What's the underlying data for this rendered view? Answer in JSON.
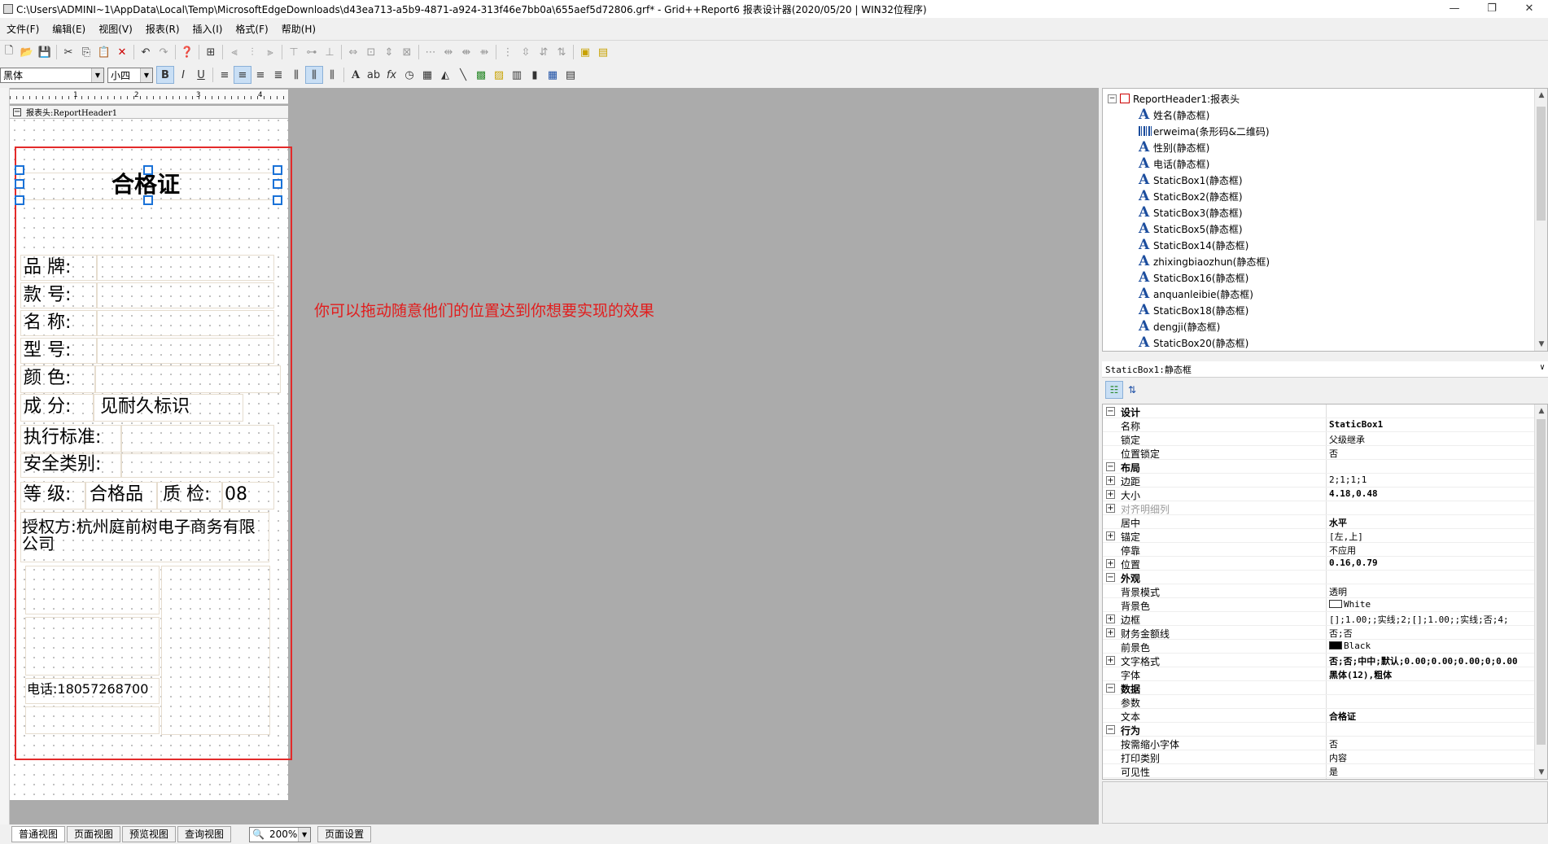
{
  "window": {
    "title": "C:\\Users\\ADMINI~1\\AppData\\Local\\Temp\\MicrosoftEdgeDownloads\\d43ea713-a5b9-4871-a924-313f46e7bb0a\\655aef5d72806.grf* - Grid++Report6 报表设计器(2020/05/20 | WIN32位程序)",
    "min": "—",
    "max": "❐",
    "close": "✕"
  },
  "menu": [
    "文件(F)",
    "编辑(E)",
    "视图(V)",
    "报表(R)",
    "插入(I)",
    "格式(F)",
    "帮助(H)"
  ],
  "font_toolbar": {
    "font_name": "黑体",
    "font_size": "小四",
    "bold": "B",
    "italic": "I",
    "underline": "U"
  },
  "section_header": "报表头:ReportHeader1",
  "ruler": {
    "numbers": [
      "1",
      "2",
      "3",
      "4"
    ]
  },
  "canvas": {
    "title": "合格证",
    "labels": {
      "brand": "品 牌:",
      "style": "款 号:",
      "name": "名 称:",
      "model": "型 号:",
      "color": "颜 色:",
      "composition": "成 分:",
      "composition_value": "见耐久标识",
      "standard": "执行标准:",
      "safety": "安全类别:",
      "grade": "等 级:",
      "grade_value": "合格品",
      "inspect": "质 检:",
      "inspect_value": "08",
      "authorizer": "授权方:杭州庭前树电子商务有限公司",
      "phone": "电话:18057268700"
    }
  },
  "annotation": "你可以拖动随意他们的位置达到你想要实现的效果",
  "tree": {
    "root": "ReportHeader1:报表头",
    "items": [
      {
        "label": "姓名(静态框)",
        "icon": "static-text"
      },
      {
        "label": "erweima(条形码&二维码)",
        "icon": "barcode"
      },
      {
        "label": "性别(静态框)",
        "icon": "static-text"
      },
      {
        "label": "电话(静态框)",
        "icon": "static-text"
      },
      {
        "label": "StaticBox1(静态框)",
        "icon": "static-text"
      },
      {
        "label": "StaticBox2(静态框)",
        "icon": "static-text"
      },
      {
        "label": "StaticBox3(静态框)",
        "icon": "static-text"
      },
      {
        "label": "StaticBox5(静态框)",
        "icon": "static-text"
      },
      {
        "label": "StaticBox14(静态框)",
        "icon": "static-text"
      },
      {
        "label": "zhixingbiaozhun(静态框)",
        "icon": "static-text"
      },
      {
        "label": "StaticBox16(静态框)",
        "icon": "static-text"
      },
      {
        "label": "anquanleibie(静态框)",
        "icon": "static-text"
      },
      {
        "label": "StaticBox18(静态框)",
        "icon": "static-text"
      },
      {
        "label": "dengji(静态框)",
        "icon": "static-text"
      },
      {
        "label": "StaticBox20(静态框)",
        "icon": "static-text"
      }
    ]
  },
  "properties": {
    "header": "StaticBox1:静态框",
    "rows": [
      {
        "type": "cat",
        "name": "设计"
      },
      {
        "name": "名称",
        "value": "StaticBox1",
        "bold": true
      },
      {
        "name": "锁定",
        "value": "父级继承"
      },
      {
        "name": "位置锁定",
        "value": "否"
      },
      {
        "type": "cat",
        "name": "布局"
      },
      {
        "name": "边距",
        "value": "2;1;1;1",
        "exp": true
      },
      {
        "name": "大小",
        "value": "4.18,0.48",
        "exp": true,
        "bold": true
      },
      {
        "name": "对齐明细列",
        "value": "",
        "exp": true,
        "dis": true
      },
      {
        "name": "居中",
        "value": "水平",
        "bold": true
      },
      {
        "name": "锚定",
        "value": "[左,上]",
        "exp": true
      },
      {
        "name": "停靠",
        "value": "不应用"
      },
      {
        "name": "位置",
        "value": "0.16,0.79",
        "exp": true,
        "bold": true
      },
      {
        "type": "cat",
        "name": "外观"
      },
      {
        "name": "背景模式",
        "value": "透明"
      },
      {
        "name": "背景色",
        "value": "White",
        "swatch": "#ffffff"
      },
      {
        "name": "边框",
        "value": "[];1.00;;实线;2;[];1.00;;实线;否;4;",
        "exp": true
      },
      {
        "name": "财务金额线",
        "value": "否;否",
        "exp": true
      },
      {
        "name": "前景色",
        "value": "Black",
        "swatch": "#000000"
      },
      {
        "name": "文字格式",
        "value": "否;否;中中;默认;0.00;0.00;0.00;0;0.00",
        "exp": true,
        "bold": true
      },
      {
        "name": "字体",
        "value": "黑体(12),粗体",
        "bold": true
      },
      {
        "type": "cat",
        "name": "数据"
      },
      {
        "name": "参数",
        "value": ""
      },
      {
        "name": "文本",
        "value": "合格证",
        "bold": true
      },
      {
        "type": "cat",
        "name": "行为"
      },
      {
        "name": "按需缩小字体",
        "value": "否"
      },
      {
        "name": "打印类别",
        "value": "内容"
      },
      {
        "name": "可见性",
        "value": "是"
      }
    ]
  },
  "bottom": {
    "tabs": [
      "普通视图",
      "页面视图",
      "预览视图",
      "查询视图"
    ],
    "zoom": "200%",
    "page_setup": "页面设置"
  },
  "colors": {
    "selection_border": "#e32a2a",
    "handle": "#1a72d8",
    "annotation": "#e11d1d",
    "canvas_bg": "#ababab"
  }
}
